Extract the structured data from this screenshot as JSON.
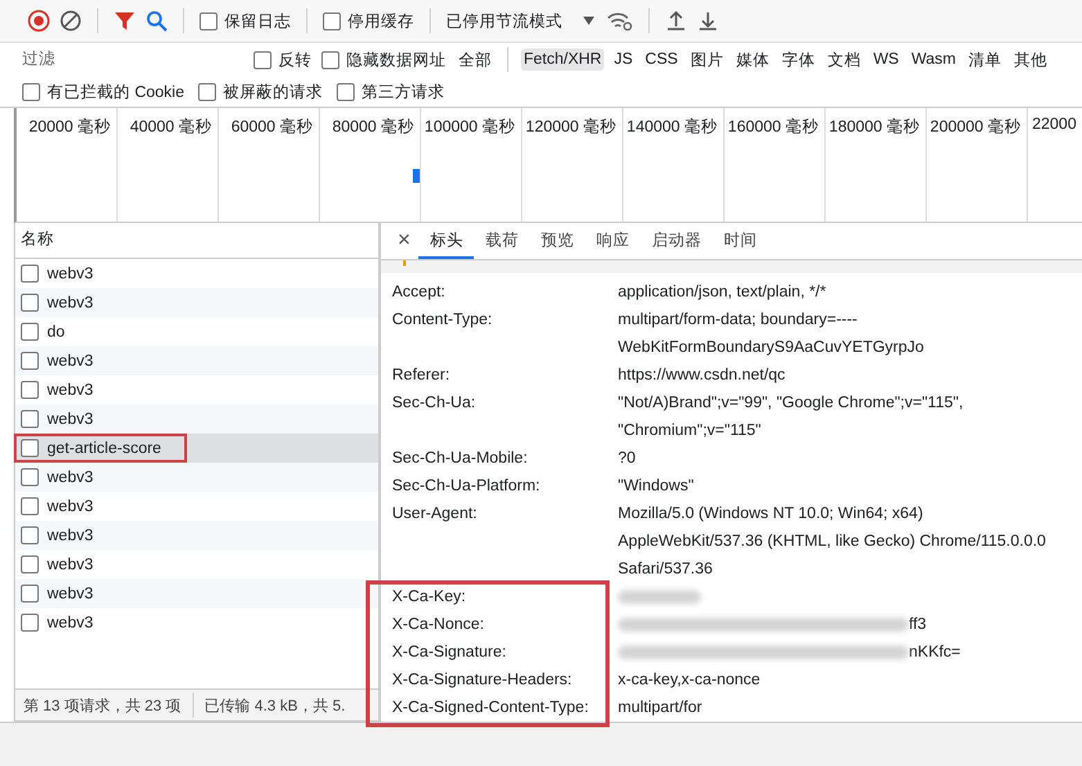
{
  "toolbar": {
    "checkboxes": [
      {
        "label": "保留日志",
        "checked": false
      },
      {
        "label": "停用缓存",
        "checked": false
      }
    ],
    "throttle": "已停用节流模式"
  },
  "filter": {
    "placeholder": "过滤",
    "checkboxes": [
      {
        "label": "反转",
        "checked": false
      },
      {
        "label": "隐藏数据网址",
        "checked": false
      }
    ],
    "types": [
      {
        "label": "全部",
        "selected": false
      },
      {
        "label": "Fetch/XHR",
        "selected": true
      },
      {
        "label": "JS",
        "selected": false
      },
      {
        "label": "CSS",
        "selected": false
      },
      {
        "label": "图片",
        "selected": false
      },
      {
        "label": "媒体",
        "selected": false
      },
      {
        "label": "字体",
        "selected": false
      },
      {
        "label": "文档",
        "selected": false
      },
      {
        "label": "WS",
        "selected": false
      },
      {
        "label": "Wasm",
        "selected": false
      },
      {
        "label": "清单",
        "selected": false
      },
      {
        "label": "其他",
        "selected": false
      }
    ]
  },
  "options": [
    {
      "label": "有已拦截的 Cookie",
      "checked": false
    },
    {
      "label": "被屏蔽的请求",
      "checked": false
    },
    {
      "label": "第三方请求",
      "checked": false
    }
  ],
  "timeline": {
    "ticks": [
      "20000 毫秒",
      "40000 毫秒",
      "60000 毫秒",
      "80000 毫秒",
      "100000 毫秒",
      "120000 毫秒",
      "140000 毫秒",
      "160000 毫秒",
      "180000 毫秒",
      "200000 毫秒",
      "22000"
    ]
  },
  "requests": {
    "column": "名称",
    "rows": [
      {
        "name": "webv3",
        "selected": false,
        "highlighted": false
      },
      {
        "name": "webv3",
        "selected": false,
        "highlighted": false
      },
      {
        "name": "do",
        "selected": false,
        "highlighted": false
      },
      {
        "name": "webv3",
        "selected": false,
        "highlighted": false
      },
      {
        "name": "webv3",
        "selected": false,
        "highlighted": false
      },
      {
        "name": "webv3",
        "selected": false,
        "highlighted": false
      },
      {
        "name": "get-article-score",
        "selected": true,
        "highlighted": true
      },
      {
        "name": "webv3",
        "selected": false,
        "highlighted": false
      },
      {
        "name": "webv3",
        "selected": false,
        "highlighted": false
      },
      {
        "name": "webv3",
        "selected": false,
        "highlighted": false
      },
      {
        "name": "webv3",
        "selected": false,
        "highlighted": false
      },
      {
        "name": "webv3",
        "selected": false,
        "highlighted": false
      },
      {
        "name": "webv3",
        "selected": false,
        "highlighted": false
      }
    ]
  },
  "status_bar": {
    "count": "第 13 项请求，共 23 项",
    "transferred": "已传输 4.3 kB，共 5."
  },
  "details": {
    "close": "×",
    "tabs": [
      {
        "label": "标头",
        "selected": true
      },
      {
        "label": "载荷",
        "selected": false
      },
      {
        "label": "预览",
        "selected": false
      },
      {
        "label": "响应",
        "selected": false
      },
      {
        "label": "启动器",
        "selected": false
      },
      {
        "label": "时间",
        "selected": false
      }
    ],
    "headers": [
      {
        "name": "Accept:",
        "value": "application/json, text/plain, */*",
        "redacted": false,
        "highlighted": false
      },
      {
        "name": "Content-Type:",
        "value": "multipart/form-data; boundary=----WebKitFormBoundaryS9AaCuvYETGyrpJo",
        "redacted": false,
        "highlighted": false
      },
      {
        "name": "Referer:",
        "value": "https://www.csdn.net/qc",
        "redacted": false,
        "highlighted": false
      },
      {
        "name": "Sec-Ch-Ua:",
        "value": "\"Not/A)Brand\";v=\"99\", \"Google Chrome\";v=\"115\", \"Chromium\";v=\"115\"",
        "redacted": false,
        "highlighted": false
      },
      {
        "name": "Sec-Ch-Ua-Mobile:",
        "value": "?0",
        "redacted": false,
        "highlighted": false
      },
      {
        "name": "Sec-Ch-Ua-Platform:",
        "value": "\"Windows\"",
        "redacted": false,
        "highlighted": false
      },
      {
        "name": "User-Agent:",
        "value": "Mozilla/5.0 (Windows NT 10.0; Win64; x64) AppleWebKit/537.36 (KHTML, like Gecko) Chrome/115.0.0.0 Safari/537.36",
        "redacted": false,
        "highlighted": false
      },
      {
        "name": "X-Ca-Key:",
        "redacted": true,
        "highlighted": true
      },
      {
        "name": "X-Ca-Nonce:",
        "value": "ff3",
        "redacted": true,
        "highlighted": true
      },
      {
        "name": "X-Ca-Signature:",
        "value": "nKKfc=",
        "redacted": true,
        "highlighted": true
      },
      {
        "name": "X-Ca-Signature-Headers:",
        "value": "x-ca-key,x-ca-nonce",
        "redacted": false,
        "highlighted": true
      },
      {
        "name": "X-Ca-Signed-Content-Type:",
        "value": "multipart/for",
        "redacted": false,
        "highlighted": true
      }
    ]
  }
}
